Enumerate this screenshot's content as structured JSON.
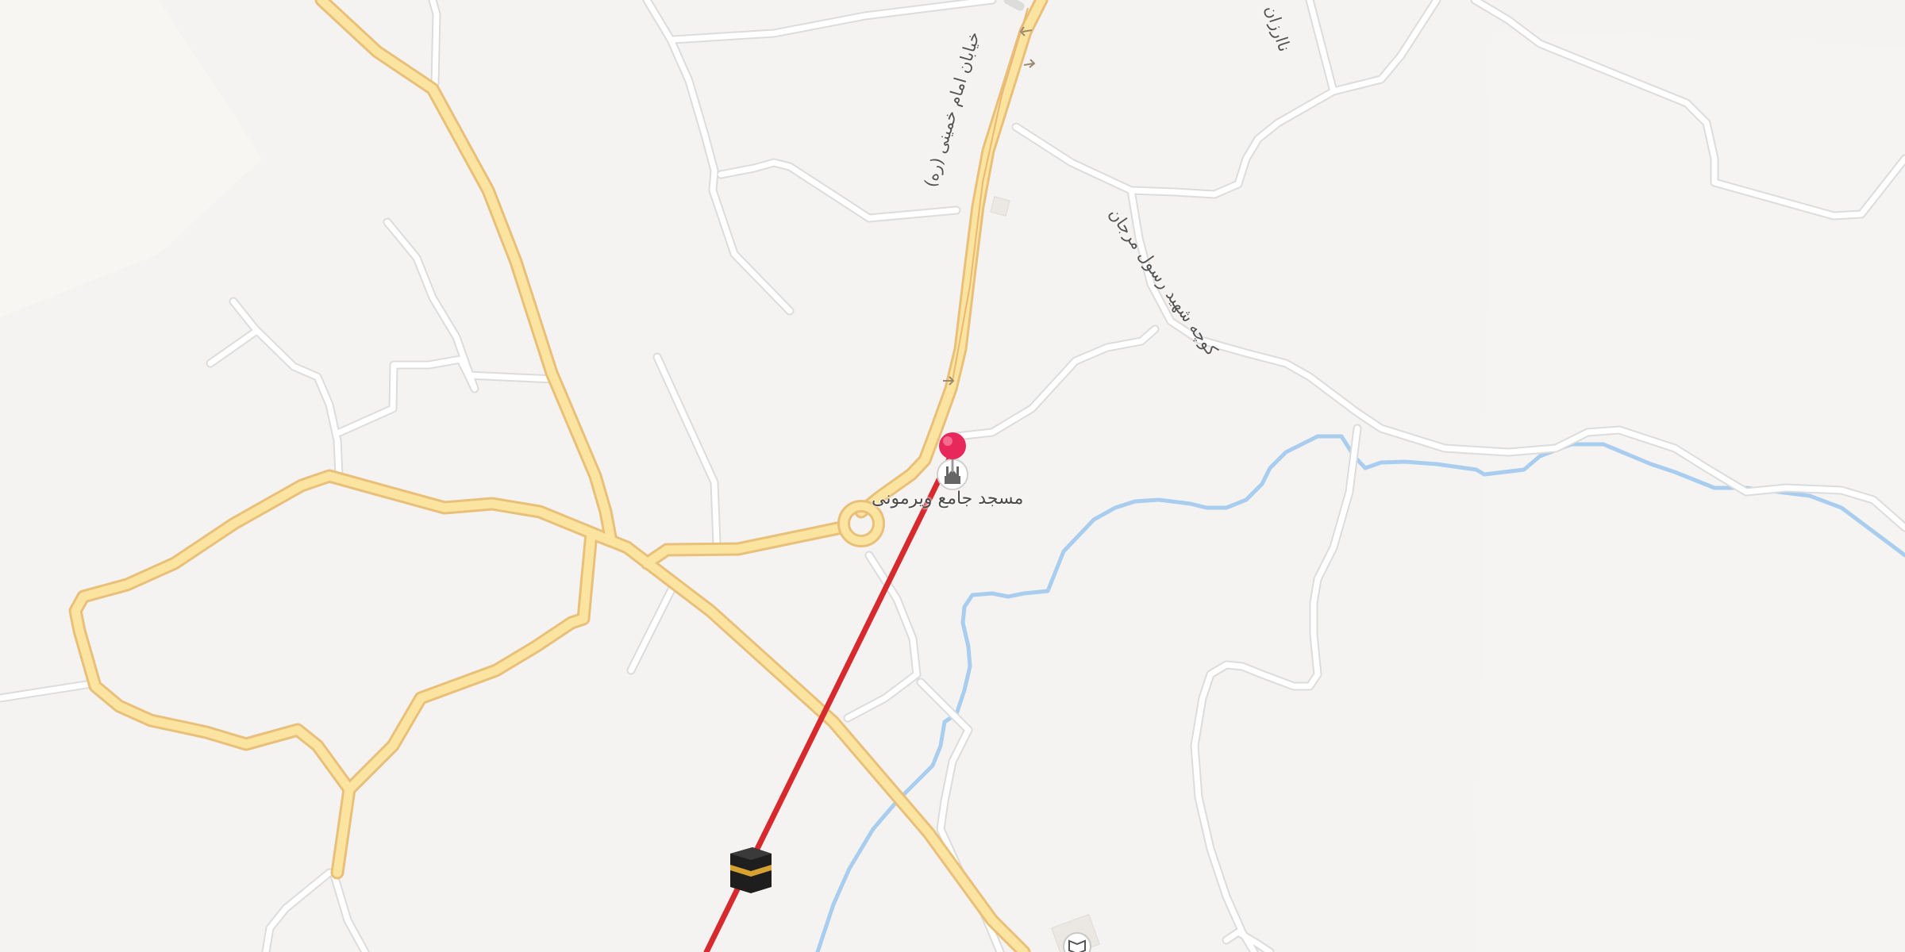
{
  "map": {
    "pin_color": "#e8275a",
    "route_color": "#d72a2f",
    "major_road_color": "#fbe3a0",
    "major_road_casing": "#ecc27e",
    "minor_road_color": "#ffffff",
    "minor_road_casing": "#dddddd",
    "river_color": "#a8cdee",
    "background_color": "#f5f3f1"
  },
  "labels": {
    "poi_name": "مسجد جامع ویرمونی",
    "road_main": "خیابان امام خمینی (ره)",
    "road_east": "کوچه شهید رسول مرجان",
    "road_north": "ناارزان"
  },
  "icons": {
    "pin": "location-pin-icon",
    "mosque": "mosque-icon",
    "kaaba": "kaaba-qibla-icon",
    "book": "book-icon",
    "direction_arrow": "one-way-arrow-icon"
  }
}
